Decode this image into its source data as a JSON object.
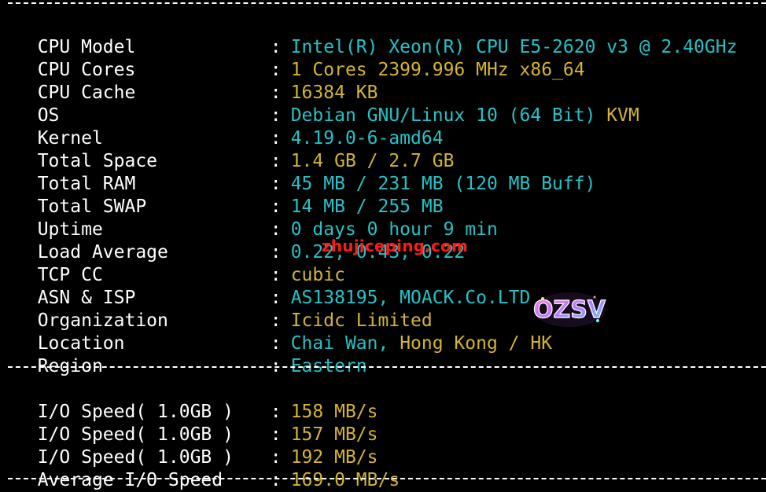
{
  "sysinfo": [
    {
      "label": "CPU Model",
      "sep": ": ",
      "value": "Intel(R) Xeon(R) CPU E5-2620 v3 @ 2.40GHz",
      "extra": ""
    },
    {
      "label": "CPU Cores",
      "sep": ": ",
      "value": "1 Cores 2399.996 MHz x86_64",
      "extra": ""
    },
    {
      "label": "CPU Cache",
      "sep": ": ",
      "value": "16384 KB",
      "extra": ""
    },
    {
      "label": "OS",
      "sep": ": ",
      "value": "Debian GNU/Linux 10 (64 Bit)",
      "extra": " KVM"
    },
    {
      "label": "Kernel",
      "sep": ": ",
      "value": "4.19.0-6-amd64",
      "extra": ""
    },
    {
      "label": "Total Space",
      "sep": ": ",
      "value": "1.4 GB / 2.7 GB",
      "extra": ""
    },
    {
      "label": "Total RAM",
      "sep": ": ",
      "value": "45 MB / 231 MB (120 MB Buff)",
      "extra": ""
    },
    {
      "label": "Total SWAP",
      "sep": ": ",
      "value": "14 MB / 255 MB",
      "extra": ""
    },
    {
      "label": "Uptime",
      "sep": ": ",
      "value": "0 days 0 hour 9 min",
      "extra": ""
    },
    {
      "label": "Load Average",
      "sep": ": ",
      "value": "0.22, 0.43, 0.22",
      "extra": ""
    },
    {
      "label": "TCP CC",
      "sep": ": ",
      "value": "cubic",
      "extra": ""
    },
    {
      "label": "ASN & ISP",
      "sep": ": ",
      "value": "AS138195, MOACK.Co.LTD",
      "extra": ""
    },
    {
      "label": "Organization",
      "sep": ": ",
      "value": "Icidc Limited",
      "extra": ""
    },
    {
      "label": "Location",
      "sep": ": ",
      "value": "Chai Wan, ",
      "extra": "Hong Kong / HK"
    },
    {
      "label": "Region",
      "sep": ": ",
      "value": "Eastern",
      "extra": ""
    }
  ],
  "io": [
    {
      "label": "I/O Speed( 1.0GB )",
      "sep": ": ",
      "value": "158 MB/s"
    },
    {
      "label": "I/O Speed( 1.0GB )",
      "sep": ": ",
      "value": "157 MB/s"
    },
    {
      "label": "I/O Speed( 1.0GB )",
      "sep": ": ",
      "value": "192 MB/s"
    },
    {
      "label": "Average I/O Speed",
      "sep": ": ",
      "value": "169.0 MB/s"
    }
  ],
  "watermark": {
    "site": "zhujiceping.com",
    "logo_text": "OZSV"
  },
  "colors": {
    "background": "#000000",
    "label": "#ffffff",
    "cyan": "#25c2c7",
    "yellow": "#d4b430",
    "watermark": "#ff1a1a"
  }
}
